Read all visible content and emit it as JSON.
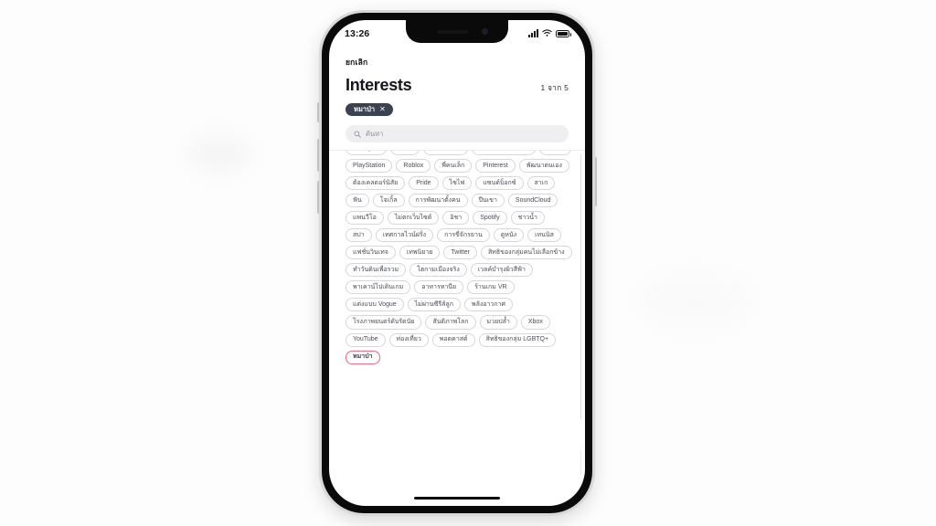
{
  "background": {
    "page_bg": "#fdfdfd"
  },
  "device": {
    "frame_color": "#0a0a0a",
    "status_bar": {
      "time": "13:26",
      "signal_icon": "cellular-signal-icon",
      "wifi_icon": "wifi-icon",
      "battery_icon": "battery-icon"
    },
    "home_indicator": "home-indicator"
  },
  "screen": {
    "nav": {
      "cancel_label": "ยกเลิก"
    },
    "header": {
      "title": "Interests",
      "counter": "1 จาก 5"
    },
    "selected": [
      {
        "label": "หมาป่า",
        "remove_icon": "✕"
      }
    ],
    "search": {
      "icon": "search-icon",
      "placeholder": "ค้นหา",
      "value": ""
    },
    "tags": [
      {
        "label": "Pub Quiz",
        "highlight": false
      },
      {
        "label": "Rave",
        "highlight": false
      },
      {
        "label": "บริหารกาย",
        "highlight": false
      },
      {
        "label": "ช่างภาพถ่ายวิดีโอ",
        "highlight": false
      },
      {
        "label": "แฟชั่น",
        "highlight": false
      },
      {
        "label": "PlayStation",
        "highlight": false
      },
      {
        "label": "Roblox",
        "highlight": false
      },
      {
        "label": "พี่คนเล็ก",
        "highlight": false
      },
      {
        "label": "Pinterest",
        "highlight": false
      },
      {
        "label": "พัฒนาตนเอง",
        "highlight": false
      },
      {
        "label": "ต้องเคลตอร์นิสัย",
        "highlight": false
      },
      {
        "label": "Pride",
        "highlight": false
      },
      {
        "label": "ไซไฟ",
        "highlight": false
      },
      {
        "label": "แซนด์บ็อกซ์",
        "highlight": false
      },
      {
        "label": "สาเก",
        "highlight": false
      },
      {
        "label": "ฟัน",
        "highlight": false
      },
      {
        "label": "โจเกิ้ล",
        "highlight": false
      },
      {
        "label": "การพัฒนาตั้งคน",
        "highlight": false
      },
      {
        "label": "ปีนเขา",
        "highlight": false
      },
      {
        "label": "SoundCloud",
        "highlight": false
      },
      {
        "label": "แพนวีโอ",
        "highlight": false
      },
      {
        "label": "ไม่ตกเว็บไซต์",
        "highlight": false
      },
      {
        "label": "อิชา",
        "highlight": false
      },
      {
        "label": "Spotify",
        "highlight": false
      },
      {
        "label": "ชาวน้ำ",
        "highlight": false
      },
      {
        "label": "สปา",
        "highlight": false
      },
      {
        "label": "เทศกาลไวน์ฝรั่ง",
        "highlight": false
      },
      {
        "label": "การขี่จักรยาน",
        "highlight": false
      },
      {
        "label": "ดูหนัง",
        "highlight": false
      },
      {
        "label": "เทนนิส",
        "highlight": false
      },
      {
        "label": "แฟชั่นวินเทจ",
        "highlight": false
      },
      {
        "label": "เทพนิยาย",
        "highlight": false
      },
      {
        "label": "Twitter",
        "highlight": false
      },
      {
        "label": "สิทธิของกลุ่มคนไม่เลือกข้าง",
        "highlight": false
      },
      {
        "label": "ทำวันดินเพื่อรวม",
        "highlight": false
      },
      {
        "label": "โฮกามเมืองจริง",
        "highlight": false
      },
      {
        "label": "เวลค์บำรุงผิวสีฟ้า",
        "highlight": false
      },
      {
        "label": "พาเคาน์ไปเดินเกม",
        "highlight": false
      },
      {
        "label": "อาหารทานีย",
        "highlight": false
      },
      {
        "label": "ร้านเกม VR",
        "highlight": false
      },
      {
        "label": "แต่งแบบ Vogue",
        "highlight": false
      },
      {
        "label": "ไม่ผ่านซีรีส์ลูก",
        "highlight": false
      },
      {
        "label": "พลังอาวกาศ",
        "highlight": false
      },
      {
        "label": "โรงภาพยนตร์ดับรัตนัย",
        "highlight": false
      },
      {
        "label": "สันติภาพโลก",
        "highlight": false
      },
      {
        "label": "มวยปล้ำ",
        "highlight": false
      },
      {
        "label": "Xbox",
        "highlight": false
      },
      {
        "label": "YouTube",
        "highlight": false
      },
      {
        "label": "ท่องเที่ยว",
        "highlight": false
      },
      {
        "label": "พอดคาสต์",
        "highlight": false
      },
      {
        "label": "สิทธิของกลุ่ม LGBTQ+",
        "highlight": false
      },
      {
        "label": "หมาป่า",
        "highlight": true
      }
    ],
    "colors": {
      "selected_chip_bg": "#3b4252",
      "highlight_border": "#e8738f",
      "tag_border": "#d6d7da",
      "search_bg": "#efeff2"
    }
  }
}
